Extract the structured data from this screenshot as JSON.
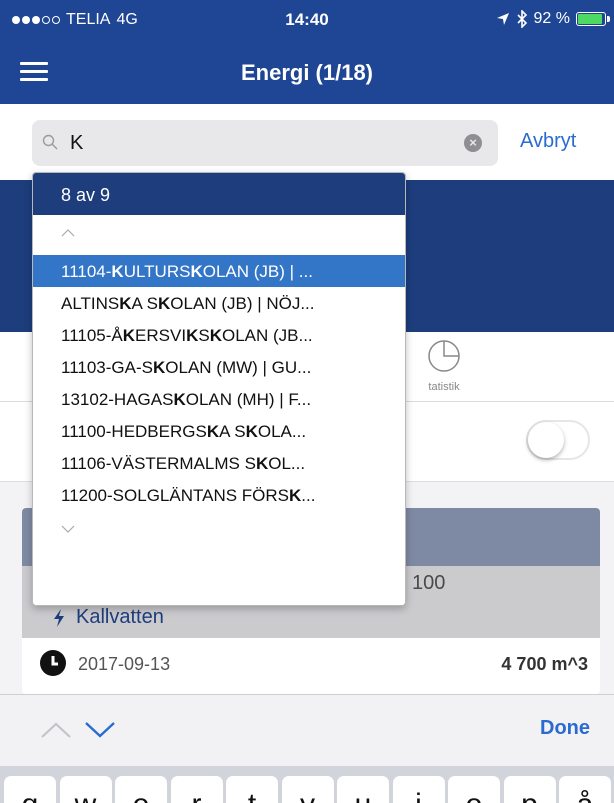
{
  "status_bar": {
    "carrier": "TELIA",
    "network": "4G",
    "time": "14:40",
    "battery": "92 %",
    "battery_level": 0.92
  },
  "nav": {
    "title": "Energi (1/18)",
    "menu_icon": "hamburger-icon"
  },
  "search": {
    "value": "K",
    "cancel_label": "Avbryt"
  },
  "dropdown": {
    "count_label": "8 av 9",
    "items": [
      {
        "parts": [
          "11104-",
          "K",
          "ULTURS",
          "K",
          "OLAN (JB) | ..."
        ]
      },
      {
        "parts": [
          "ALTINS",
          "K",
          "A S",
          "K",
          "OLAN (JB) | NÖJ..."
        ]
      },
      {
        "parts": [
          "11105-Å",
          "K",
          "ERSVI",
          "K",
          "S",
          "K",
          "OLAN (JB..."
        ]
      },
      {
        "parts": [
          "11103-GA-S",
          "K",
          "OLAN (MW) | GU..."
        ]
      },
      {
        "parts": [
          "13102-HAGAS",
          "K",
          "OLAN (MH) | F..."
        ]
      },
      {
        "parts": [
          "11100-HEDBERGS",
          "K",
          "A S",
          "K",
          "OLA..."
        ]
      },
      {
        "parts": [
          "11106-VÄSTERMALMS S",
          "K",
          "OL..."
        ]
      },
      {
        "parts": [
          "11200-SOLGLÄNTANS FÖRS",
          "K",
          "..."
        ]
      }
    ]
  },
  "tabs": {
    "statistics_label": "tatistik"
  },
  "card": {
    "meter_number": "100",
    "meter_type": "Kallvatten",
    "reading_date": "2017-09-13",
    "reading_value": "4 700 m^3"
  },
  "keyboard": {
    "done_label": "Done",
    "keys": [
      "q",
      "w",
      "e",
      "r",
      "t",
      "y",
      "u",
      "i",
      "o",
      "p",
      "å"
    ]
  },
  "colors": {
    "nav_blue": "#1f4694",
    "selected_blue": "#3375c6",
    "link_blue": "#2a6bd1"
  }
}
